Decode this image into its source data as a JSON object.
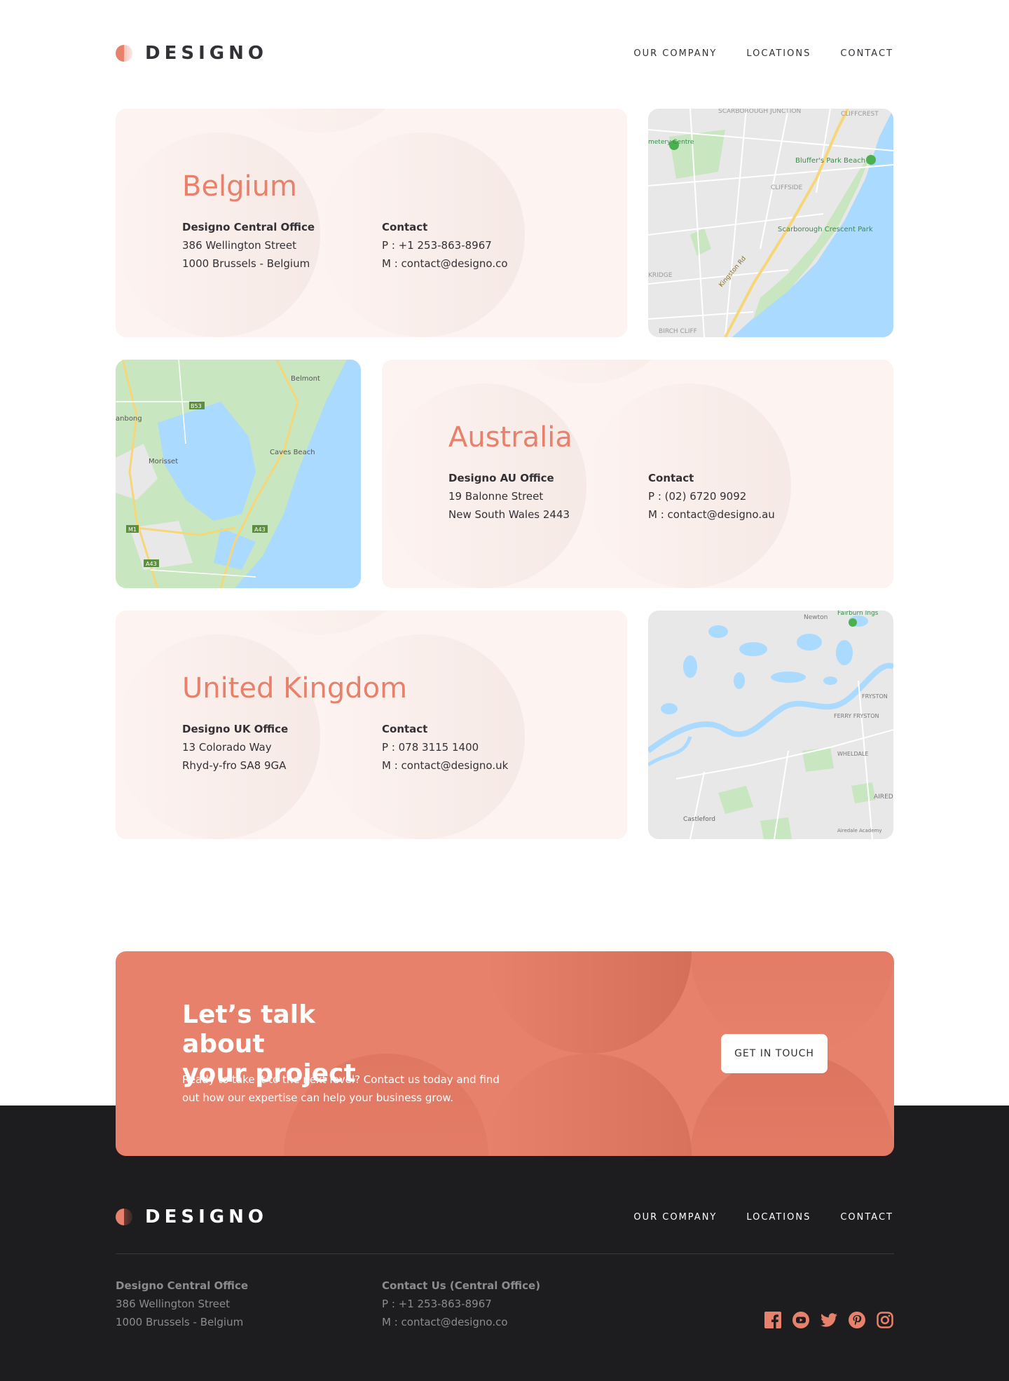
{
  "brand": {
    "name": "DESIGNO"
  },
  "nav": [
    "OUR COMPANY",
    "LOCATIONS",
    "CONTACT"
  ],
  "locations": [
    {
      "country": "Belgium",
      "office": {
        "title": "Designo Central Office",
        "line1": "386 Wellington Street",
        "line2": "1000 Brussels - Belgium"
      },
      "contact": {
        "title": "Contact",
        "phone": "P : +1 253-863-8967",
        "email": "M : contact@designo.co"
      },
      "map_labels": [
        "SCARBOROUGH JUNCTION",
        "CLIFFCREST",
        "Bluffer's Park Beach",
        "CLIFFSIDE",
        "Scarborough Crescent Park",
        "Kingston Rd",
        "BIRCH CLIFF",
        "KRIDGE",
        "metery Centre"
      ]
    },
    {
      "country": "Australia",
      "office": {
        "title": "Designo AU Office",
        "line1": "19 Balonne Street",
        "line2": "New South Wales 2443"
      },
      "contact": {
        "title": "Contact",
        "phone": "P : (02) 6720 9092",
        "email": "M : contact@designo.au"
      },
      "map_labels": [
        "Belmont",
        "anbong",
        "B53",
        "Morisset",
        "Caves Beach",
        "M1",
        "A43",
        "A43"
      ]
    },
    {
      "country": "United Kingdom",
      "office": {
        "title": "Designo UK Office",
        "line1": "13  Colorado Way",
        "line2": "Rhyd-y-fro SA8 9GA"
      },
      "contact": {
        "title": "Contact",
        "phone": "P : 078 3115 1400",
        "email": "M : contact@designo.uk"
      },
      "map_labels": [
        "Newton",
        "Fairburn Ings",
        "FRYSTON",
        "FERRY FRYSTON",
        "WHELDALE",
        "Castleford",
        "AIRED",
        "Airedale Academy"
      ]
    }
  ],
  "cta": {
    "title_line1": "Let’s talk about",
    "title_line2": "your project",
    "text": "Ready to take it to the next level? Contact us today and find out how our expertise can help your business grow.",
    "button": "GET IN TOUCH"
  },
  "footer": {
    "office": {
      "title": "Designo Central Office",
      "line1": "386 Wellington Street",
      "line2": "1000 Brussels - Belgium"
    },
    "contact": {
      "title": "Contact Us (Central Office)",
      "phone": "P : +1 253-863-8967",
      "email": "M : contact@designo.co"
    },
    "social": [
      "facebook-icon",
      "youtube-icon",
      "twitter-icon",
      "pinterest-icon",
      "instagram-icon"
    ]
  },
  "colors": {
    "accent": "#e7816b",
    "card_bg": "#fdf3f0",
    "dark": "#1d1c1e",
    "text": "#333136",
    "water": "#aadaff",
    "park": "#c8e6c0",
    "land": "#e8e8e8"
  }
}
